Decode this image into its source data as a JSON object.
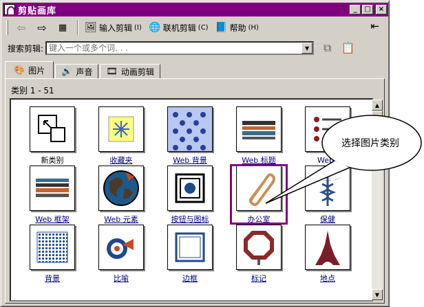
{
  "window": {
    "title": "剪贴画库"
  },
  "toolbar": {
    "back_icon": "arrow-left-icon",
    "forward_icon": "arrow-right-icon",
    "all_categories_icon": "grid-icon",
    "import_label": "输入剪辑",
    "import_key": "(I)",
    "online_label": "联机剪辑",
    "online_key": "(C)",
    "help_label": "帮助",
    "help_key": "(H)"
  },
  "search": {
    "label": "搜索剪辑:",
    "placeholder": "键入一个或多个词. . ."
  },
  "tabs": [
    {
      "label": "图片",
      "icon": "picture-icon"
    },
    {
      "label": "声音",
      "icon": "speaker-icon"
    },
    {
      "label": "动画剪辑",
      "icon": "film-icon"
    }
  ],
  "panel": {
    "category_count": "类别 1 - 51"
  },
  "categories": [
    {
      "label": "新类别",
      "icon": "new-category-icon",
      "linked": false
    },
    {
      "label": "收藏夹",
      "icon": "favorites-icon",
      "linked": true
    },
    {
      "label": "Web 背景",
      "icon": "web-background-icon",
      "linked": true
    },
    {
      "label": "Web 标题",
      "icon": "web-banner-icon",
      "linked": true
    },
    {
      "label": "Web 项目符号",
      "icon": "web-bullets-icon",
      "linked": true
    },
    {
      "label": "Web 框架",
      "icon": "web-frames-icon",
      "linked": true
    },
    {
      "label": "Web 元素",
      "icon": "web-elements-icon",
      "linked": true
    },
    {
      "label": "按钮与图标",
      "icon": "buttons-icons-icon",
      "linked": true
    },
    {
      "label": "办公室",
      "icon": "paperclip-icon",
      "linked": true,
      "selected": true
    },
    {
      "label": "保健",
      "icon": "caduceus-icon",
      "linked": true
    },
    {
      "label": "背景",
      "icon": "background-pattern-icon",
      "linked": true
    },
    {
      "label": "比喻",
      "icon": "metaphor-icon",
      "linked": true
    },
    {
      "label": "边框",
      "icon": "border-frame-icon",
      "linked": true
    },
    {
      "label": "标记",
      "icon": "sign-icon",
      "linked": true
    },
    {
      "label": "地点",
      "icon": "eiffel-tower-icon",
      "linked": true
    }
  ],
  "callout": {
    "text": "选择图片类别"
  }
}
